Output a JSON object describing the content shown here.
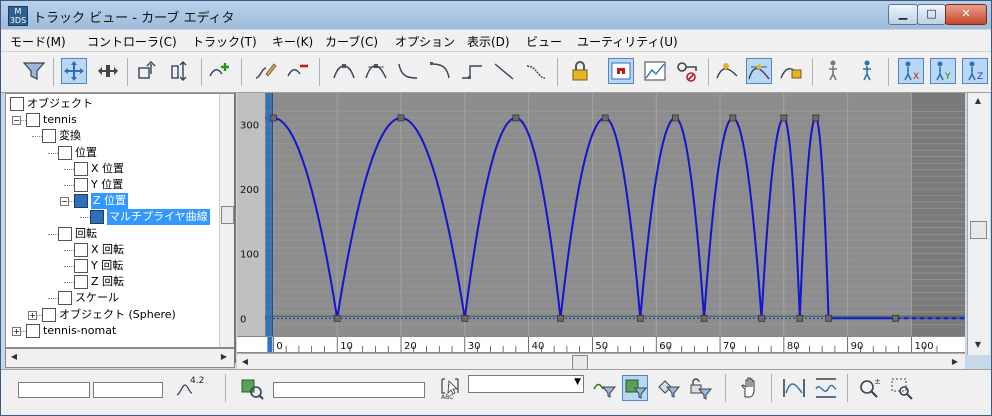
{
  "window": {
    "title": "トラック ビュー - カーブ エディタ",
    "app_icon_text": "M 3DS",
    "controls": {
      "minimize": "▁",
      "maximize": "□",
      "close": "✕"
    }
  },
  "menu": [
    "モード(M)",
    "コントローラ(C)",
    "トラック(T)",
    "キー(K)",
    "カーブ(C)",
    "オプション",
    "表示(D)",
    "ビュー",
    "ユーティリティ(U)"
  ],
  "toolbar": {
    "icons": [
      "filter-icon",
      "move-keys-icon",
      "move-keys-horizontal-icon",
      "snap-frames-icon",
      "scale-values-icon",
      "add-keys-icon",
      "draw-curves-icon",
      "reduce-keys-icon",
      "tangent-auto-icon",
      "tangent-custom-icon",
      "tangent-fast-icon",
      "tangent-slow-icon",
      "tangent-step-icon",
      "tangent-linear-icon",
      "tangent-smooth-icon",
      "lock-selection-icon",
      "snap-frames-toggle-icon",
      "parameter-curve-out-of-range-icon",
      "lock-tangents-icon",
      "show-keyable-icon",
      "show-all-tangents-icon",
      "show-tangents-icon",
      "lock-tangents-2-icon",
      "isolate-curve-icon",
      "show-biped-rotation-icon",
      "show-biped-x-curve-icon",
      "show-biped-y-curve-icon",
      "show-biped-z-curve-icon"
    ]
  },
  "tree": {
    "items": [
      {
        "label": "オブジェクト",
        "icon": "world-icon",
        "indent": 0,
        "expander": ""
      },
      {
        "label": "tennis",
        "icon": "object-box-icon",
        "indent": 1,
        "expander": "−"
      },
      {
        "label": "変換",
        "icon": "transform-icon",
        "indent": 2,
        "expander": ""
      },
      {
        "label": "位置",
        "icon": "position-icon",
        "indent": 3,
        "expander": ""
      },
      {
        "label": "X 位置",
        "icon": "curve-track-icon",
        "indent": 4,
        "expander": ""
      },
      {
        "label": "Y 位置",
        "icon": "curve-track-icon",
        "indent": 4,
        "expander": ""
      },
      {
        "label": "Z 位置",
        "icon": "curve-track-icon",
        "indent": 4,
        "expander": "−",
        "selected": true
      },
      {
        "label": "マルチプライヤ曲線",
        "icon": "multiplier-icon",
        "indent": 5,
        "expander": "",
        "selected": true
      },
      {
        "label": "回転",
        "icon": "rotation-icon",
        "indent": 3,
        "expander": ""
      },
      {
        "label": "X 回転",
        "icon": "curve-track-icon",
        "indent": 4,
        "expander": ""
      },
      {
        "label": "Y 回転",
        "icon": "curve-track-icon",
        "indent": 4,
        "expander": ""
      },
      {
        "label": "Z 回転",
        "icon": "curve-track-icon",
        "indent": 4,
        "expander": ""
      },
      {
        "label": "スケール",
        "icon": "scale-icon",
        "indent": 3,
        "expander": ""
      },
      {
        "label": "オブジェクト (Sphere)",
        "icon": "sphere-icon",
        "indent": 2,
        "expander": "+"
      },
      {
        "label": "tennis-nomat",
        "icon": "material-icon",
        "indent": 1,
        "expander": "+"
      }
    ]
  },
  "chart_data": {
    "type": "line",
    "title": "",
    "xlabel": "",
    "ylabel": "",
    "xlim": [
      -1,
      104
    ],
    "ylim": [
      -15,
      330
    ],
    "x_ticks": [
      0,
      10,
      20,
      30,
      40,
      50,
      60,
      70,
      80,
      90,
      100
    ],
    "y_ticks": [
      0,
      100,
      200,
      300
    ],
    "series": [
      {
        "name": "",
        "color": "#1414d2",
        "keys": [
          {
            "x": 0,
            "y": 310
          },
          {
            "x": 10,
            "y": 0
          },
          {
            "x": 20,
            "y": 310
          },
          {
            "x": 30,
            "y": 0
          },
          {
            "x": 38,
            "y": 310
          },
          {
            "x": 45,
            "y": 0
          },
          {
            "x": 52,
            "y": 310
          },
          {
            "x": 57.5,
            "y": 0
          },
          {
            "x": 63,
            "y": 310
          },
          {
            "x": 67.5,
            "y": 0
          },
          {
            "x": 72,
            "y": 310
          },
          {
            "x": 76.5,
            "y": 0
          },
          {
            "x": 80,
            "y": 310
          },
          {
            "x": 82.5,
            "y": 0
          },
          {
            "x": 85,
            "y": 310
          },
          {
            "x": 87,
            "y": 0
          },
          {
            "x": 97.5,
            "y": 0
          }
        ]
      }
    ],
    "current_frame": 0,
    "grid": true
  },
  "status": {
    "field1": "",
    "field2": "",
    "value_label": "4.2",
    "track_field": "",
    "combo_value": "",
    "icons": [
      "curve-value-icon",
      "zoom-selected-object-icon",
      "select-by-name-icon",
      "filter-selected-icon",
      "filter-selected-on-icon",
      "filter-animated-icon",
      "filter-unlocked-icon",
      "pan-icon",
      "frame-horizontal-icon",
      "frame-values-icon",
      "zoom-icon",
      "zoom-region-icon"
    ]
  },
  "colors": {
    "graph_bg": "#8d8d8d",
    "graph_inactive": "#7a7a7a",
    "curve": "#1414d2",
    "key": "#6b6b6b",
    "time_slider": "#2a73c9",
    "selection": "#3399ff"
  }
}
